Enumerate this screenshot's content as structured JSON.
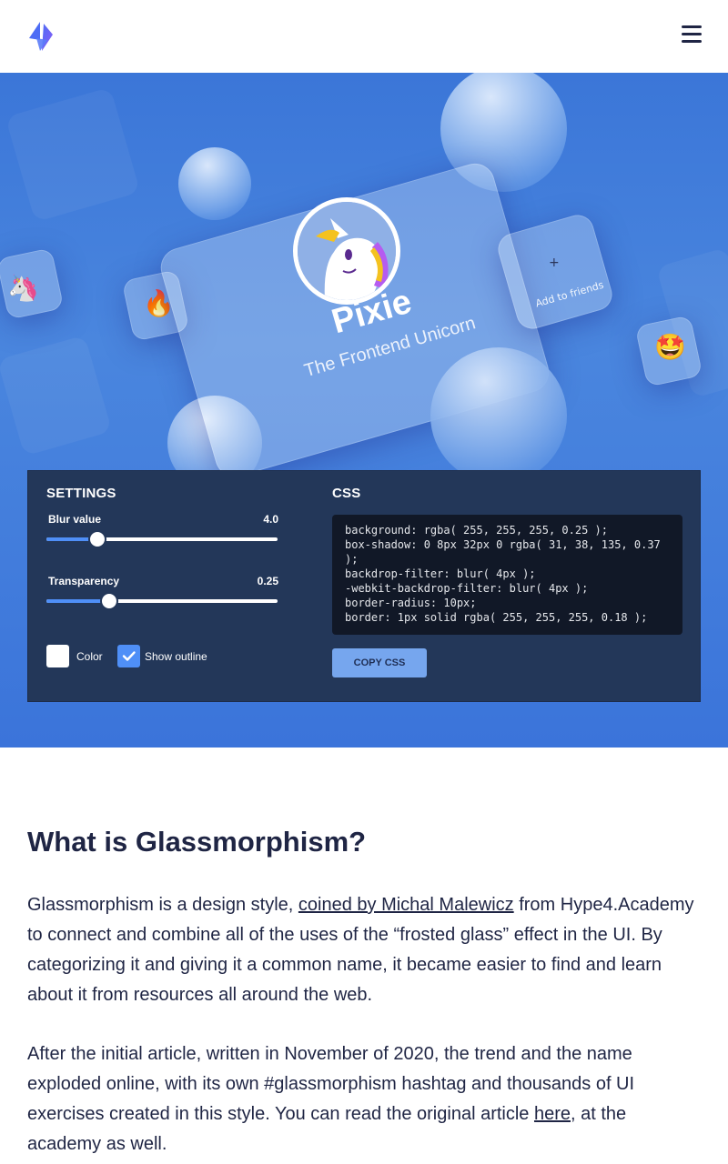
{
  "brand": {
    "accent": "#4f8ff7",
    "text_dark": "#1f2544",
    "hero_bg": "#3b76d8",
    "panel_bg": "#233759"
  },
  "header": {
    "logo_icon": "bolt-logo-icon",
    "menu_icon": "hamburger-menu-icon"
  },
  "demo_card": {
    "name": "Pixie",
    "subtitle": "The Frontend Unicorn",
    "avatar_icon": "unicorn-avatar-icon"
  },
  "side_cards": {
    "unicorn_emoji": "🦄",
    "fire_emoji": "🔥",
    "star_eyes_emoji": "🤩",
    "add_friend_icon": "+",
    "add_friends_label": "Add to friends"
  },
  "settings": {
    "title": "SETTINGS",
    "blur": {
      "label": "Blur value",
      "value": "4.0",
      "fraction": 0.22
    },
    "transparency": {
      "label": "Transparency",
      "value": "0.25",
      "fraction": 0.27
    },
    "color_checkbox": {
      "label": "Color",
      "checked": false
    },
    "outline_checkbox": {
      "label": "Show outline",
      "checked": true,
      "icon": "checkmark-icon"
    }
  },
  "css_panel": {
    "title": "CSS",
    "code": "background: rgba( 255, 255, 255, 0.25 );\nbox-shadow: 0 8px 32px 0 rgba( 31, 38, 135, 0.37 );\nbackdrop-filter: blur( 4px );\n-webkit-backdrop-filter: blur( 4px );\nborder-radius: 10px;\nborder: 1px solid rgba( 255, 255, 255, 0.18 );",
    "copy_button": "COPY CSS"
  },
  "article": {
    "heading": "What is Glassmorphism?",
    "p1_before": "Glassmorphism is a design style, ",
    "p1_link": "coined by Michal Malewicz",
    "p1_after": " from Hype4.Academy to connect and combine all of the uses of the “frosted glass” effect in the UI. By categorizing it and giving it a common name, it became easier to find and learn about it from resources all around the web.",
    "p2_before": "After the initial article, written in November of 2020, the trend and the name exploded online, with its own #glassmorphism hashtag and thousands of UI exercises created in this style. You can read the original article ",
    "p2_link": "here",
    "p2_after": ", at the academy as well."
  }
}
